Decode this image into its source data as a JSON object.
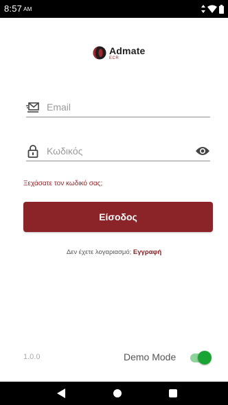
{
  "status_bar": {
    "time": "8:57",
    "ampm": "AM",
    "icons": [
      "data-arrows-icon",
      "wifi-icon",
      "battery-icon"
    ]
  },
  "logo": {
    "name": "Admate",
    "sub": "ECR"
  },
  "login_form": {
    "email_placeholder": "Email",
    "email_value": "",
    "password_placeholder": "Κωδικός",
    "password_value": "",
    "forgot_label": "Ξεχάσατε τον κωδικό σας;",
    "login_label": "Είσοδος"
  },
  "signup": {
    "prompt": "Δεν έχετε λογαριασμό;",
    "link": "Εγγραφή"
  },
  "footer": {
    "version": "1.0.0",
    "demo_label": "Demo Mode",
    "demo_enabled": true
  },
  "colors": {
    "brand": "#8a2428",
    "toggle_on": "#1aa433"
  }
}
